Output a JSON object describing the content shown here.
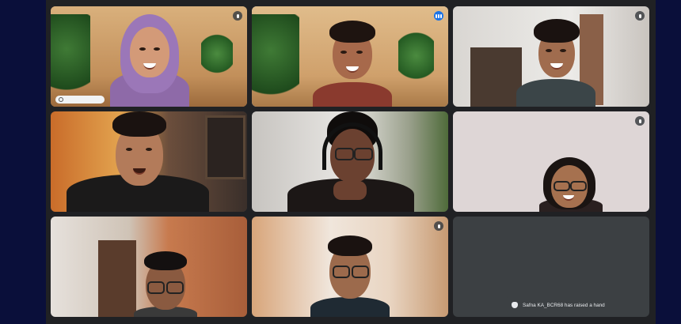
{
  "participants": [
    {
      "id": "p1",
      "muted": true,
      "speaking": false
    },
    {
      "id": "p2",
      "muted": false,
      "speaking": true
    },
    {
      "id": "p3",
      "muted": true,
      "speaking": false
    },
    {
      "id": "p4",
      "muted": false,
      "speaking": false
    },
    {
      "id": "p5",
      "muted": false,
      "speaking": false
    },
    {
      "id": "p6",
      "muted": true,
      "speaking": false
    },
    {
      "id": "p7",
      "muted": false,
      "speaking": false
    },
    {
      "id": "p8",
      "muted": true,
      "speaking": false
    }
  ],
  "notification": {
    "icon": "hand-raised-icon",
    "text": "Safna KA_BCR68 has raised a hand"
  },
  "colors": {
    "page_bg": "#0a0f3a",
    "grid_bg": "#202124",
    "active_speaker": "#8ab4f8",
    "speaking_badge": "#1a73e8"
  }
}
